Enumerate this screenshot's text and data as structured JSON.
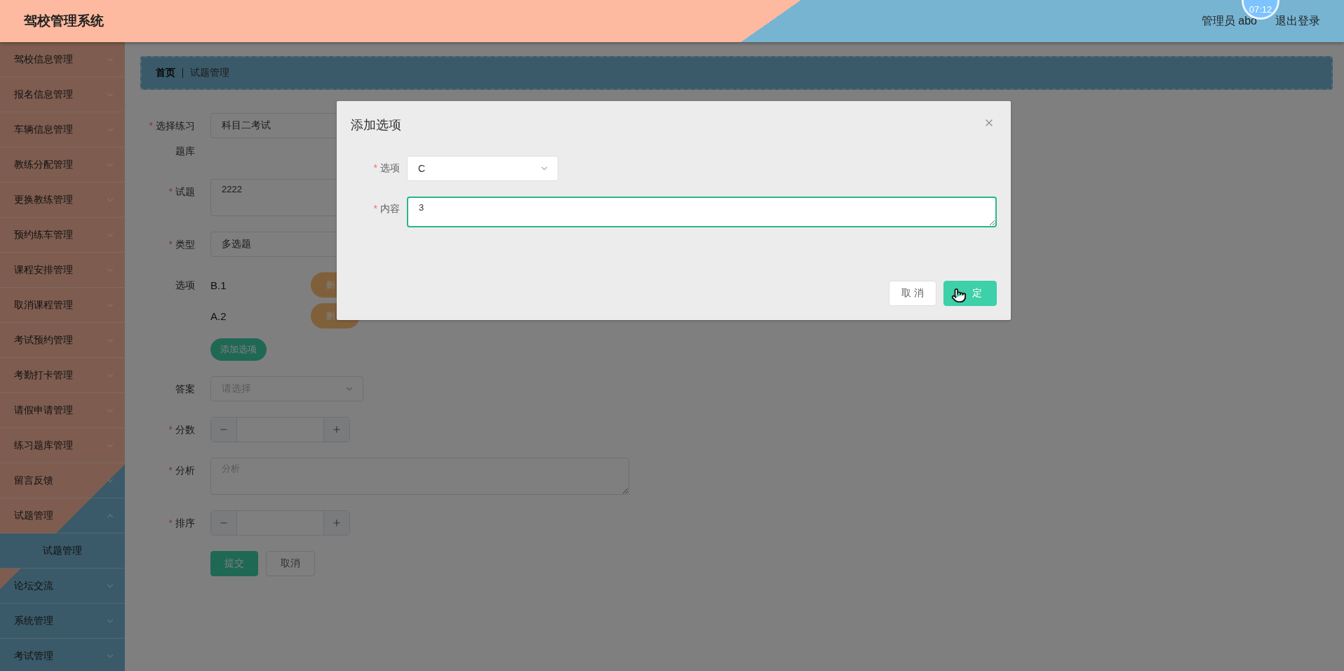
{
  "header": {
    "title": "驾校管理系统",
    "clock": "07:12",
    "user": "管理员 abo",
    "logout": "退出登录"
  },
  "sidebar": {
    "items": [
      {
        "label": "驾校信息管理",
        "expanded": false
      },
      {
        "label": "报名信息管理",
        "expanded": false
      },
      {
        "label": "车辆信息管理",
        "expanded": false
      },
      {
        "label": "教练分配管理",
        "expanded": false
      },
      {
        "label": "更换教练管理",
        "expanded": false
      },
      {
        "label": "预约练车管理",
        "expanded": false
      },
      {
        "label": "课程安排管理",
        "expanded": false
      },
      {
        "label": "取消课程管理",
        "expanded": false
      },
      {
        "label": "考试预约管理",
        "expanded": false
      },
      {
        "label": "考勤打卡管理",
        "expanded": false
      },
      {
        "label": "请假申请管理",
        "expanded": false
      },
      {
        "label": "练习题库管理",
        "expanded": false
      },
      {
        "label": "留言反馈",
        "expanded": false
      },
      {
        "label": "试题管理",
        "expanded": true,
        "children": [
          {
            "label": "试题管理",
            "selected": true
          }
        ]
      },
      {
        "label": "论坛交流",
        "expanded": false
      },
      {
        "label": "系统管理",
        "expanded": false
      },
      {
        "label": "考试管理",
        "expanded": false
      }
    ]
  },
  "breadcrumb": [
    "首页",
    "试题管理"
  ],
  "form": {
    "fields": [
      {
        "kind": "select",
        "label": "选择练习题库",
        "required_mark": "*",
        "value": "科目二考试"
      },
      {
        "kind": "textarea",
        "label": "试题",
        "required_mark": "*",
        "value": "2222"
      },
      {
        "kind": "select",
        "label": "类型",
        "required_mark": "*",
        "value": "多选题"
      },
      {
        "kind": "options",
        "label": "选项",
        "options": [
          {
            "text": "B.1",
            "button": "删"
          },
          {
            "text": "A.2",
            "button": "删"
          }
        ],
        "add_button": "添加选项"
      },
      {
        "kind": "select",
        "label": "答案",
        "placeholder": "请选择"
      },
      {
        "kind": "stepper",
        "label": "分数",
        "required_mark": "*"
      },
      {
        "kind": "textarea",
        "label": "分析",
        "required_mark": "*",
        "placeholder": "分析"
      },
      {
        "kind": "stepper",
        "label": "排序",
        "required_mark": "*"
      }
    ],
    "buttons": [
      {
        "label": "提交",
        "kind": "primary"
      },
      {
        "label": "取消",
        "kind": "default"
      }
    ]
  },
  "dialog": {
    "title": "添加选项",
    "fields": [
      {
        "kind": "select",
        "label": "选项",
        "required_mark": "*",
        "value": "C"
      },
      {
        "kind": "textarea",
        "label": "内容",
        "required_mark": "*",
        "value": "3",
        "focused": true
      }
    ],
    "buttons": [
      {
        "label": "取 消",
        "kind": "default"
      },
      {
        "label": "定",
        "kind": "primary"
      }
    ]
  }
}
